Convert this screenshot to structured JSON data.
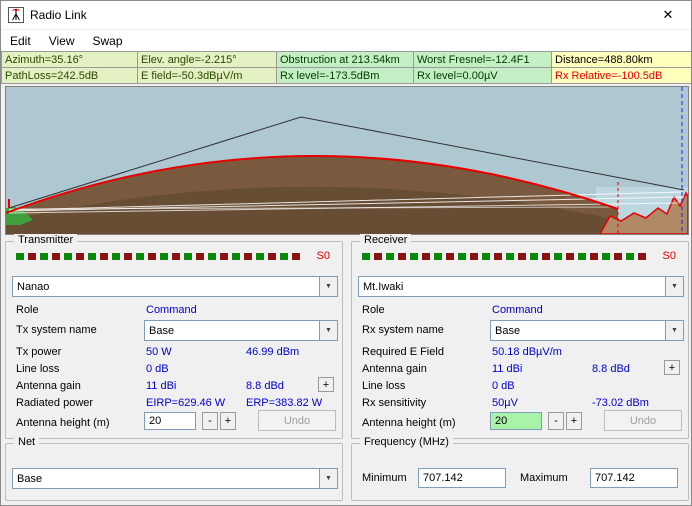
{
  "window": {
    "title": "Radio Link",
    "close_label": "✕"
  },
  "icons": {
    "dropdown_arrow": "▼"
  },
  "menu": {
    "edit": "Edit",
    "view": "View",
    "swap": "Swap"
  },
  "status": {
    "azimuth": {
      "text": "Azimuth=35.16°",
      "bg": "#e4f1c2",
      "fg": "#2a4a00"
    },
    "elevation": {
      "text": "Elev. angle=-2.215°",
      "bg": "#e4f1c2",
      "fg": "#2a4a00"
    },
    "obstruction": {
      "text": "Obstruction at 213.54km",
      "bg": "#c4eec4",
      "fg": "#004000"
    },
    "fresnel": {
      "text": "Worst Fresnel=-12.4F1",
      "bg": "#c4eec4",
      "fg": "#004000"
    },
    "distance": {
      "text": "Distance=488.80km",
      "bg": "#ffffbd",
      "fg": "#000000"
    },
    "pathloss": {
      "text": "PathLoss=242.5dB",
      "bg": "#e4f1c2",
      "fg": "#2a4a00"
    },
    "efield": {
      "text": "E field=-50.3dBµV/m",
      "bg": "#e4f1c2",
      "fg": "#2a4a00"
    },
    "rxlevel_dbm": {
      "text": "Rx level=-173.5dBm",
      "bg": "#c4eec4",
      "fg": "#004000"
    },
    "rxlevel_uv": {
      "text": "Rx level=0.00µV",
      "bg": "#c4eec4",
      "fg": "#004000"
    },
    "rx_relative": {
      "text": "Rx Relative=-100.5dB",
      "bg": "#ffffbd",
      "fg": "#e80000"
    }
  },
  "meter": {
    "segments": 24,
    "colors": [
      "#0a8a0a",
      "#8a1212"
    ]
  },
  "profile": {
    "colors": {
      "sky": "#aec8d2",
      "ground": "#7a5a3e",
      "water": "#bdd7e0",
      "mountain": "#b08a66",
      "curve": "#e80000",
      "grass": "#3da03d",
      "los": "#ffffff",
      "ray": "#303030",
      "marker_blue": "#2222ee"
    }
  },
  "transmitter": {
    "title": "Transmitter",
    "meter_label": "S0",
    "unit": "Nanao",
    "role_label": "Role",
    "role_value": "Command",
    "system_label": "Tx system name",
    "system_value": "Base",
    "rows": [
      {
        "label": "Tx power",
        "v1": "50 W",
        "v2": "46.99 dBm"
      },
      {
        "label": "Line loss",
        "v1": "0 dB",
        "v2": ""
      },
      {
        "label": "Antenna gain",
        "v1": "11 dBi",
        "v2": "8.8 dBd"
      },
      {
        "label": "Radiated power",
        "v1": "EIRP=629.46 W",
        "v2": "ERP=383.82 W"
      }
    ],
    "plus_label": "+",
    "minus_label": "-",
    "height_label": "Antenna height (m)",
    "height_value": "20",
    "undo_label": "Undo"
  },
  "receiver": {
    "title": "Receiver",
    "meter_label": "S0",
    "unit": "Mt.Iwaki",
    "role_label": "Role",
    "role_value": "Command",
    "system_label": "Rx system name",
    "system_value": "Base",
    "rows": [
      {
        "label": "Required E Field",
        "v1": "50.18 dBµV/m",
        "v2": ""
      },
      {
        "label": "Antenna gain",
        "v1": "11 dBi",
        "v2": "8.8 dBd"
      },
      {
        "label": "Line loss",
        "v1": "0 dB",
        "v2": ""
      },
      {
        "label": "Rx sensitivity",
        "v1": "50µV",
        "v2": "-73.02 dBm"
      }
    ],
    "plus_label": "+",
    "minus_label": "-",
    "height_label": "Antenna height (m)",
    "height_value": "20",
    "height_bg": "#a9f2a9",
    "undo_label": "Undo"
  },
  "net": {
    "title": "Net",
    "value": "Base"
  },
  "frequency": {
    "title": "Frequency (MHz)",
    "min_label": "Minimum",
    "min_value": "707.142",
    "max_label": "Maximum",
    "max_value": "707.142"
  }
}
